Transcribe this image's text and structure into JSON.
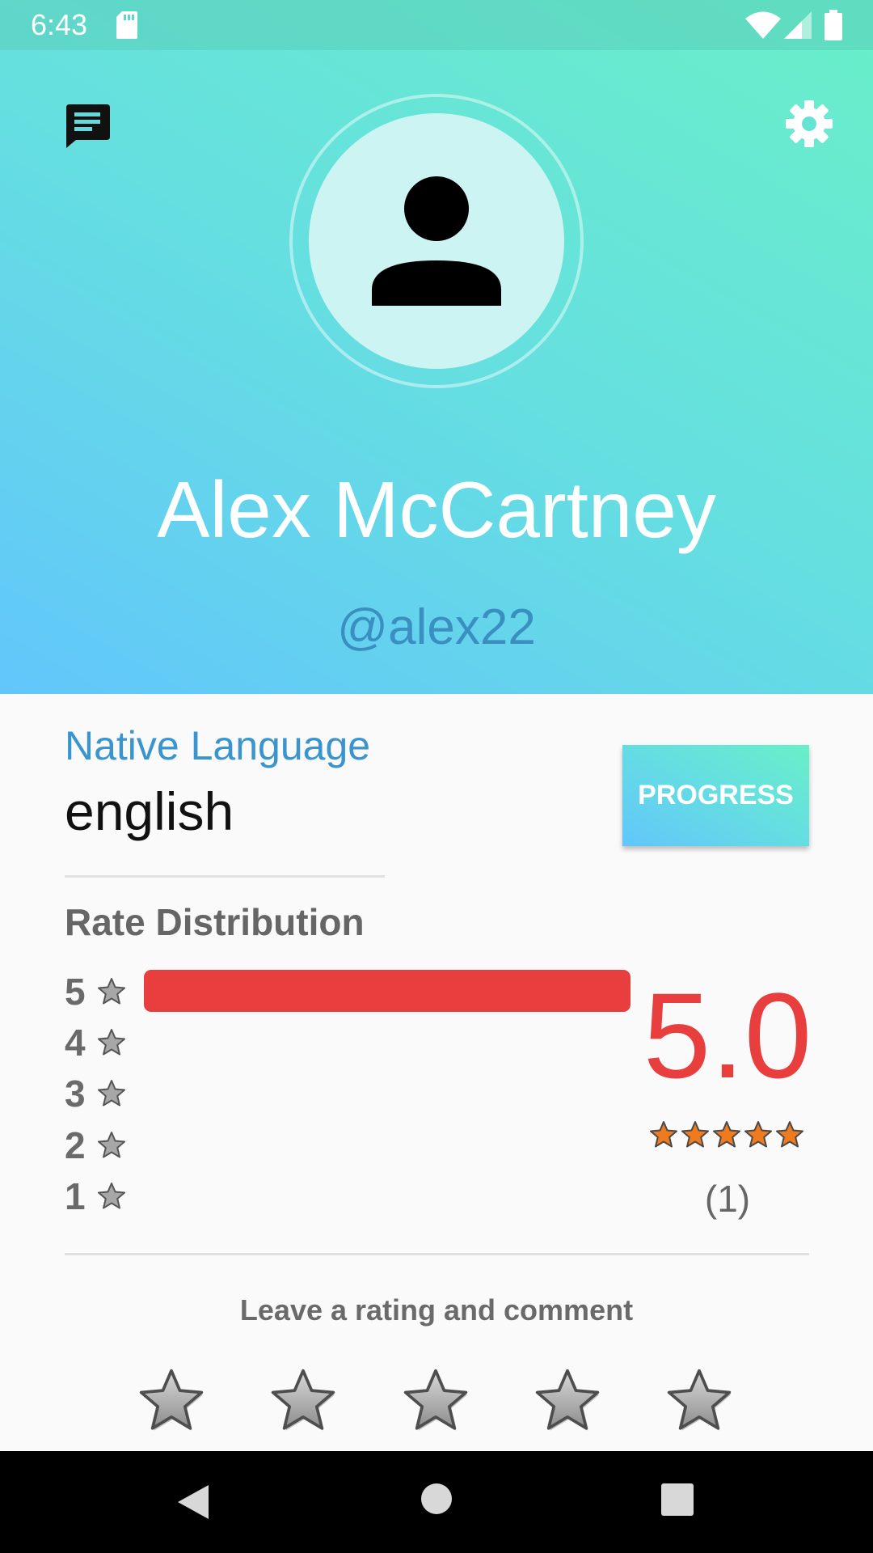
{
  "status_bar": {
    "time": "6:43",
    "icons": [
      "sd-card-icon",
      "wifi-icon",
      "cell-signal-icon",
      "battery-icon"
    ]
  },
  "header": {
    "chat_icon": "chat-icon",
    "settings_icon": "gear-icon",
    "avatar_icon": "person-icon",
    "name": "Alex McCartney",
    "handle": "@alex22"
  },
  "profile": {
    "native_language_label": "Native Language",
    "native_language_value": "english",
    "progress_button": "PROGRESS"
  },
  "rating": {
    "title": "Rate Distribution",
    "rows": [
      {
        "stars": "5",
        "share": 1.0
      },
      {
        "stars": "4",
        "share": 0
      },
      {
        "stars": "3",
        "share": 0
      },
      {
        "stars": "2",
        "share": 0
      },
      {
        "stars": "1",
        "share": 0
      }
    ],
    "average": "5.0",
    "average_stars": 5,
    "count": "(1)"
  },
  "leave_rating": {
    "prompt": "Leave a rating and comment",
    "selected_stars": 0,
    "max_stars": 5
  },
  "nav": {
    "back_icon": "back-icon",
    "home_icon": "home-icon",
    "recents_icon": "recents-icon"
  },
  "colors": {
    "accent_blue": "#3a95cf",
    "score_red": "#e83e3e",
    "gradient_start": "#62c6fb",
    "gradient_end": "#69efc8",
    "star_orange": "#f07a1e"
  }
}
